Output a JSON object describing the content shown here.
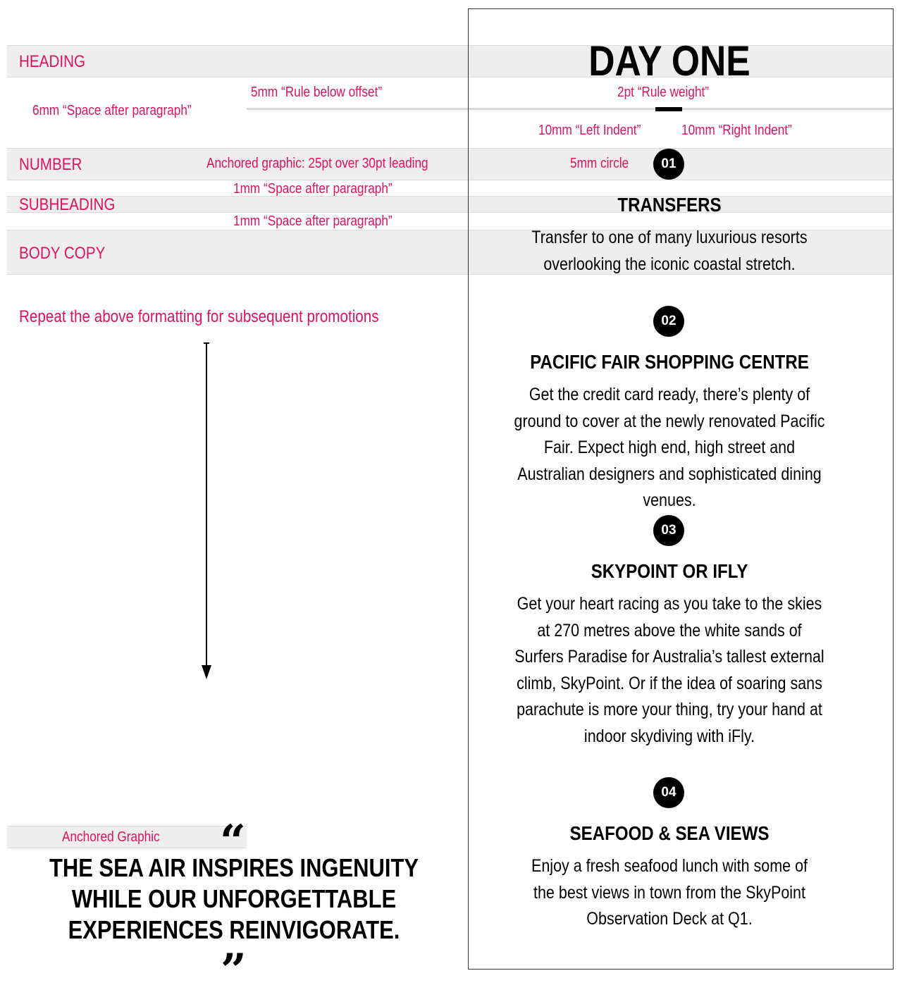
{
  "spec": {
    "labels": {
      "heading": "HEADING",
      "number": "NUMBER",
      "subheading": "SUBHEADING",
      "body_copy": "BODY COPY"
    },
    "notes": {
      "rule_below_offset": "5mm “Rule below offset”",
      "space_after_heading": "6mm “Space after paragraph”",
      "rule_weight": "2pt “Rule weight”",
      "left_indent": "10mm “Left Indent”",
      "right_indent": "10mm “Right Indent”",
      "anchored_graphic": "Anchored graphic: 25pt over 30pt leading",
      "circle": "5mm circle",
      "space_after_number": "1mm “Space after paragraph”",
      "space_after_subheading": "1mm “Space after paragraph”",
      "repeat": "Repeat the above formatting for subsequent promotions",
      "anchored_graphic_quote": "Anchored Graphic"
    }
  },
  "panel": {
    "title": "DAY ONE",
    "items": [
      {
        "number": "01",
        "title": "TRANSFERS",
        "body": "Transfer to one of many luxurious resorts overlooking the iconic coastal stretch."
      },
      {
        "number": "02",
        "title": "PACIFIC FAIR SHOPPING CENTRE",
        "body": "Get the credit card ready, there’s plenty of ground to cover at the newly renovated Pacific Fair. Expect high end, high street and Australian designers and sophisticated dining venues."
      },
      {
        "number": "03",
        "title": "SKYPOINT OR IFLY",
        "body": "Get your heart racing as you take to the skies at 270 metres above the white sands of Surfers Paradise for Australia’s tallest external climb, SkyPoint. Or if the idea of soaring sans parachute is more your thing, try your hand at indoor skydiving with iFly."
      },
      {
        "number": "04",
        "title": "SEAFOOD & SEA VIEWS",
        "body": "Enjoy a fresh seafood lunch with some of the best views in town from the SkyPoint Observation Deck at Q1."
      }
    ]
  },
  "quote": {
    "open_mark": "“",
    "text": "THE SEA AIR INSPIRES INGENUITY WHILE OUR UNFORGETTABLE EXPERIENCES REINVIGORATE.",
    "close_mark": "”"
  }
}
